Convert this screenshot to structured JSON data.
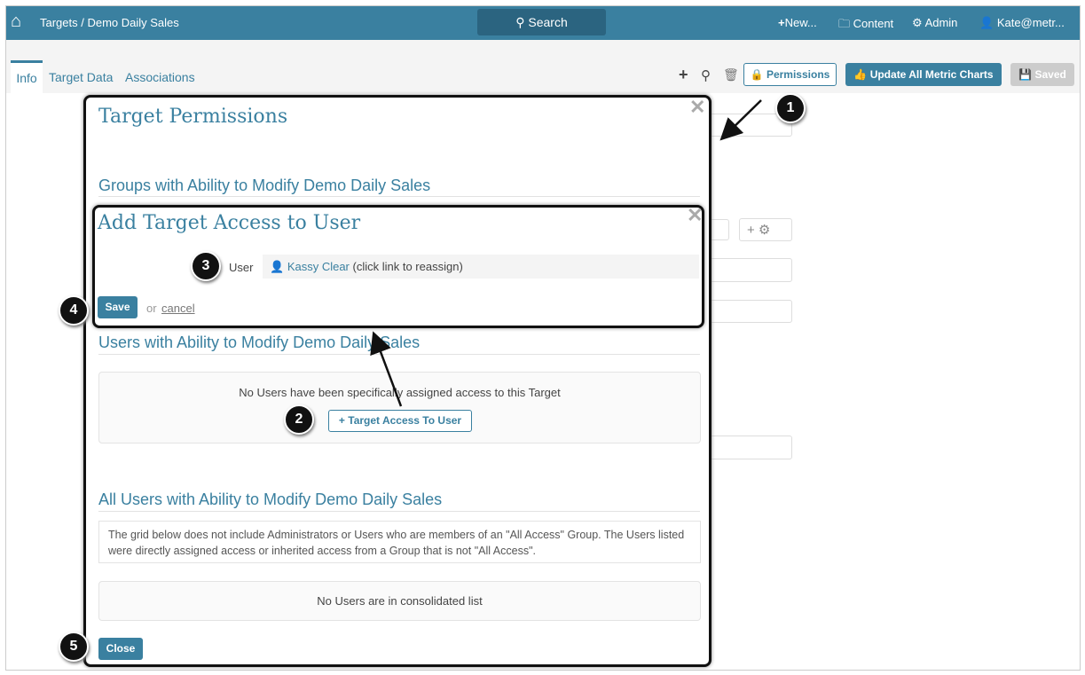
{
  "header": {
    "breadcrumb": "Targets / Demo Daily Sales",
    "search": "Search",
    "new": "New...",
    "content": "Content",
    "admin": "Admin",
    "user": "Kate@metr..."
  },
  "tabs": [
    "Info",
    "Target Data",
    "Associations"
  ],
  "toolbar": {
    "permissions": "Permissions",
    "update": "Update All Metric Charts",
    "saved": "Saved"
  },
  "modal": {
    "title": "Target Permissions",
    "groups_heading": "Groups with Ability to Modify Demo Daily Sales",
    "users_heading": "Users with Ability to Modify Demo Daily Sales",
    "no_users": "No Users have been specifically assigned access to this Target",
    "add_button": "Target Access To User",
    "all_heading": "All Users with Ability to Modify Demo Daily Sales",
    "note": "The grid below does not include Administrators or Users who are members of an \"All Access\" Group. The Users listed were directly assigned access or inherited access from a Group that is not \"All Access\".",
    "consolidated": "No Users are in consolidated list",
    "close": "Close"
  },
  "subdialog": {
    "title": "Add Target Access to User",
    "user_label": "User",
    "user_name": "Kassy Clear",
    "reassign": "(click link to reassign)",
    "save": "Save",
    "or": "or",
    "cancel": "cancel"
  },
  "callouts": [
    "1",
    "2",
    "3",
    "4",
    "5"
  ]
}
